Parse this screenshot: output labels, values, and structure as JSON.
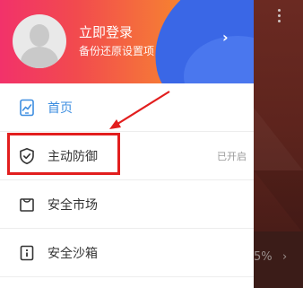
{
  "header": {
    "login_title": "立即登录",
    "login_subtitle": "备份还原设置项",
    "chevron": "›"
  },
  "menu": {
    "items": [
      {
        "label": "首页",
        "icon": "trend-chart-icon",
        "status": "",
        "active": true
      },
      {
        "label": "主动防御",
        "icon": "shield-check-icon",
        "status": "已开启",
        "active": false
      },
      {
        "label": "安全市场",
        "icon": "shopping-bag-icon",
        "status": "",
        "active": false
      },
      {
        "label": "安全沙箱",
        "icon": "sandbox-icon",
        "status": "",
        "active": false
      }
    ]
  },
  "background_app": {
    "percent_text": "5%",
    "arrow": "›"
  },
  "colors": {
    "accent_blue": "#3d8ee0",
    "highlight_red": "#e21e1e",
    "header_pink": "#f2326a",
    "header_orange": "#f7951f",
    "header_blue": "#3a67e6"
  }
}
